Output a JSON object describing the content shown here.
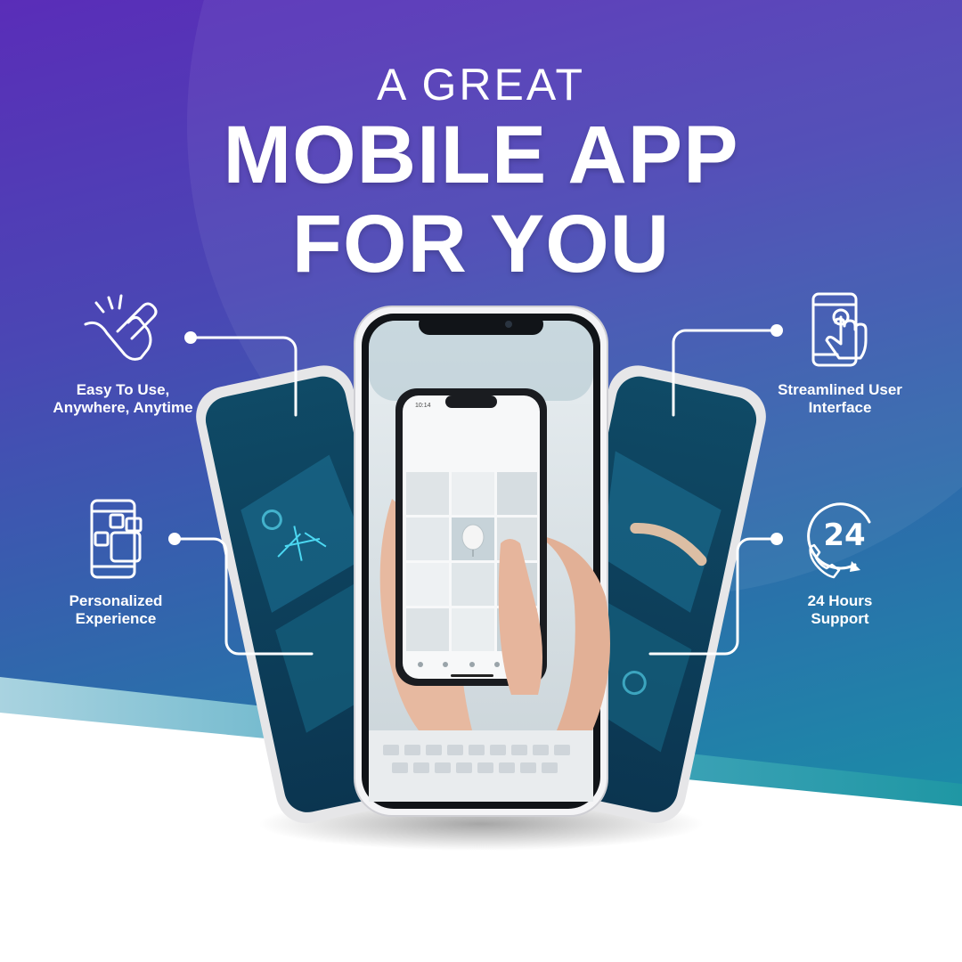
{
  "headline": {
    "line1": "A GREAT",
    "line2": "MOBILE APP",
    "line3": "FOR YOU"
  },
  "features": {
    "easy_use": {
      "line1": "Easy To Use,",
      "line2": "Anywhere, Anytime",
      "icon": "touch-hand-icon"
    },
    "personalized": {
      "line1": "Personalized",
      "line2": "Experience",
      "icon": "phone-widgets-icon"
    },
    "streamlined_ui": {
      "line1": "Streamlined User",
      "line2": "Interface",
      "icon": "phone-tap-icon"
    },
    "support": {
      "line1": "24 Hours",
      "line2": "Support",
      "icon": "phone-24-icon",
      "icon_text": "24"
    }
  },
  "inner_phone": {
    "time": "10:14"
  },
  "colors": {
    "bg_top": "#5b2fbb",
    "bg_mid": "#3a56b0",
    "bg_bottom": "#1f7fa5",
    "accent_band": "#2a9dab"
  }
}
